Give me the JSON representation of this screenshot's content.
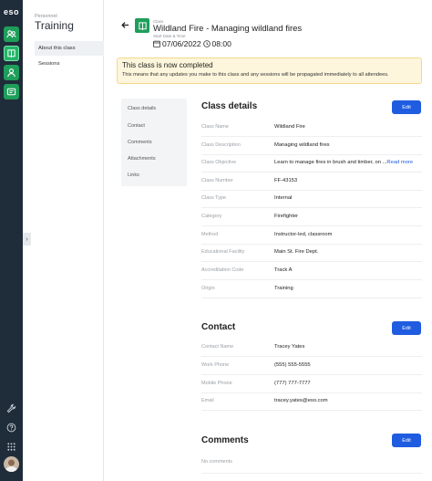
{
  "app": {
    "logo_text": "eso",
    "rail_icons": [
      "people-icon",
      "book-icon",
      "person-badge-icon",
      "id-card-icon"
    ],
    "rail_bottom_icons": [
      "wrench-icon",
      "help-icon",
      "apps-grid-icon"
    ],
    "accent": "#1e9e5a"
  },
  "sidenav": {
    "eyebrow": "Personnel",
    "title": "Training",
    "items": [
      {
        "label": "About this class",
        "active": true
      },
      {
        "label": "Sessions",
        "active": false
      }
    ]
  },
  "header": {
    "eyebrow": "Class",
    "title": "Wildland Fire - Managing wildland fires",
    "subtitle": "Start Date & Time",
    "date": "07/06/2022",
    "time": "08:00"
  },
  "banner": {
    "title": "This class is now completed",
    "text": "This means that any updates you make to this class and any sessions will be propagated immediately to all attendees."
  },
  "section_tabs": [
    "Class details",
    "Contact",
    "Comments",
    "Attachments",
    "Links"
  ],
  "class_details": {
    "title": "Class details",
    "edit_label": "Edit",
    "rows": [
      {
        "label": "Class Name",
        "value": "Wildland Fire"
      },
      {
        "label": "Class Description",
        "value": "Managing wildland fires"
      },
      {
        "label": "Class Objective",
        "value": "Learn to manage fires in brush and timber, on ...",
        "more": "Read more"
      },
      {
        "label": "Class Number",
        "value": "FF-43153"
      },
      {
        "label": "Class Type",
        "value": "Internal"
      },
      {
        "label": "Category",
        "value": "Firefighter"
      },
      {
        "label": "Method",
        "value": "Instructor-led, classroom"
      },
      {
        "label": "Educational Facility",
        "value": "Main St. Fire Dept."
      },
      {
        "label": "Accreditation Code",
        "value": "Track A"
      },
      {
        "label": "Origin",
        "value": "Training"
      }
    ]
  },
  "contact": {
    "title": "Contact",
    "edit_label": "Edit",
    "rows": [
      {
        "label": "Contact Name",
        "value": "Tracey Yates"
      },
      {
        "label": "Work Phone",
        "value": "(555) 555-5555"
      },
      {
        "label": "Mobile Phone",
        "value": "(777) 777-7777"
      },
      {
        "label": "Email",
        "value": "tracey.yates@eso.com"
      }
    ]
  },
  "comments": {
    "title": "Comments",
    "edit_label": "Edit",
    "empty_text": "No comments"
  }
}
